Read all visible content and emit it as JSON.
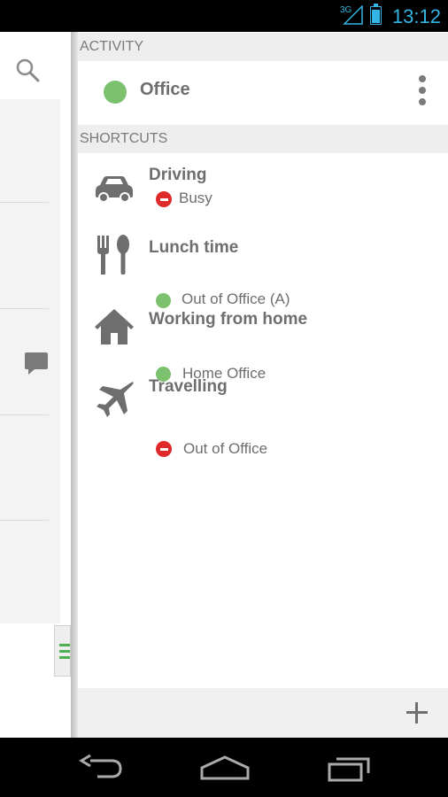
{
  "status_bar": {
    "network": "3G",
    "time": "13:12",
    "battery_level": 0.8
  },
  "drawer": {
    "activity_header": "ACTIVITY",
    "current_activity": {
      "label": "Office",
      "status_color": "#7cc26e"
    },
    "shortcuts_header": "SHORTCUTS",
    "shortcuts": [
      {
        "title": "Driving",
        "status": "Busy",
        "status_type": "busy",
        "icon": "car-icon"
      },
      {
        "title": "Lunch time",
        "status": "Out of Office (A)",
        "status_type": "available",
        "icon": "fork-spoon-icon"
      },
      {
        "title": "Working from home",
        "status": "Home Office",
        "status_type": "available",
        "icon": "house-icon"
      },
      {
        "title": "Travelling",
        "status": "Out of Office",
        "status_type": "busy",
        "icon": "airplane-icon"
      }
    ]
  },
  "colors": {
    "available": "#7cc26e",
    "busy": "#e02a2a",
    "accent": "#33b5e5"
  }
}
